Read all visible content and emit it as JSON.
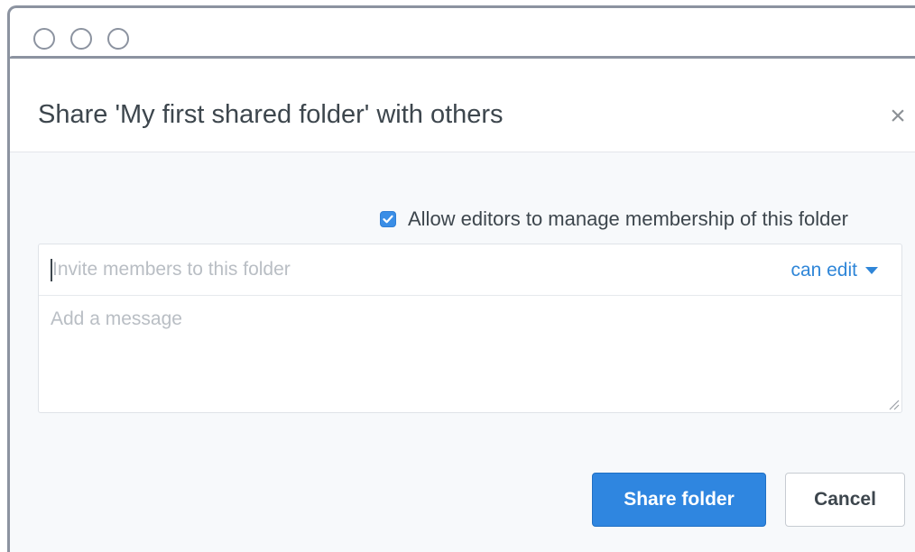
{
  "window": {
    "controls": [
      "circle-icon",
      "circle-icon",
      "circle-icon"
    ]
  },
  "dialog": {
    "title": "Share 'My first shared folder' with others",
    "close_icon": "close-icon",
    "close_glyph": "×"
  },
  "allow_membership": {
    "label": "Allow editors to manage membership of this folder",
    "checked": true
  },
  "invite": {
    "placeholder": "Invite members to this folder",
    "permission": "can edit"
  },
  "message": {
    "placeholder": "Add a message"
  },
  "actions": {
    "share_label": "Share folder",
    "cancel_label": "Cancel"
  },
  "colors": {
    "accent": "#2f86e0",
    "link": "#2f86d8",
    "frame": "#8c93a0",
    "text": "#3d464d"
  }
}
